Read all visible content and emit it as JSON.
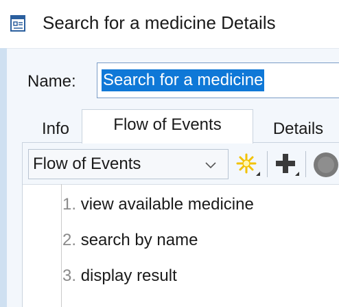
{
  "window": {
    "title": "Search for a medicine Details",
    "icon": "details-icon"
  },
  "form": {
    "name_label": "Name:",
    "name_value": "Search for a medicine"
  },
  "tabs": [
    {
      "label": "Info",
      "active": false
    },
    {
      "label": "Flow of Events",
      "active": true
    },
    {
      "label": "Details",
      "active": false
    }
  ],
  "toolbar": {
    "dropdown_value": "Flow of Events",
    "buttons": [
      {
        "icon": "new-sparkle-icon"
      },
      {
        "icon": "add-plus-icon"
      },
      {
        "icon": "gray-circle-icon"
      }
    ]
  },
  "flow_steps": [
    {
      "num": "1.",
      "text": "view available medicine"
    },
    {
      "num": "2.",
      "text": "search by name"
    },
    {
      "num": "3.",
      "text": "display result"
    }
  ],
  "colors": {
    "selection": "#0f78d7",
    "accent_yellow": "#f2c200",
    "icon_dark": "#3a3a3a"
  }
}
